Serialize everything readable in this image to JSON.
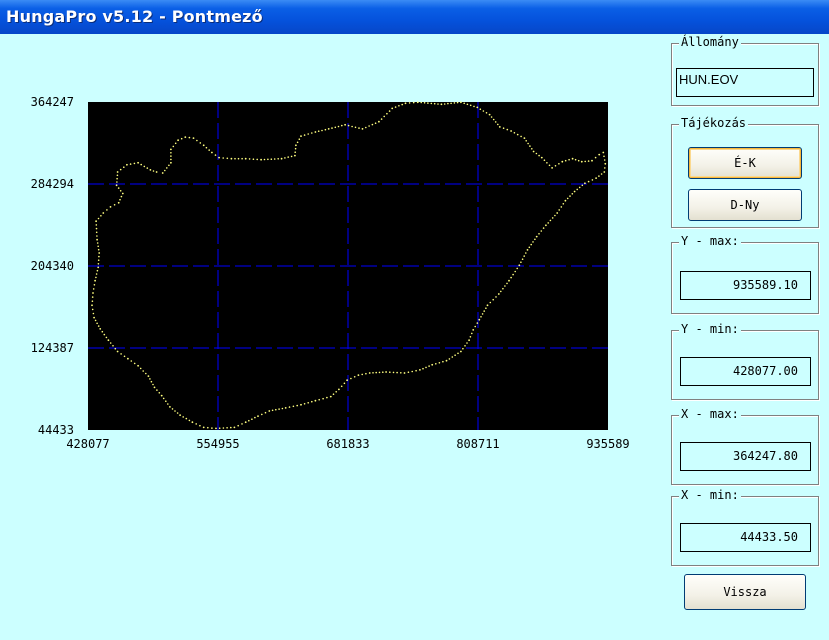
{
  "window": {
    "title": "HungaPro v5.12 - Pontmező"
  },
  "allomany": {
    "label": "Állomány",
    "value": "HUN.EOV"
  },
  "tajekozas": {
    "label": "Tájékozás",
    "ek_label": "É-K",
    "dny_label": "D-Ny"
  },
  "ymax": {
    "label": "Y - max:",
    "value": "935589.10"
  },
  "ymin": {
    "label": "Y - min:",
    "value": "428077.00"
  },
  "xmax": {
    "label": "X - max:",
    "value": "364247.80"
  },
  "xmin": {
    "label": "X - min:",
    "value": "44433.50"
  },
  "vissza_label": "Vissza",
  "colors": {
    "plot_bg": "#000000",
    "grid": "#0000ff",
    "points": "#ffff80",
    "client_bg": "#ccffff",
    "title_bar": "#0552dc"
  },
  "chart_data": {
    "type": "scatter",
    "title": "",
    "xlabel": "",
    "ylabel": "",
    "xlim": [
      428077,
      935589
    ],
    "ylim": [
      44433,
      364247
    ],
    "x_ticks": [
      "428077",
      "554955",
      "681833",
      "808711",
      "935589"
    ],
    "y_ticks": [
      "364247",
      "284294",
      "204340",
      "124387",
      "44433"
    ],
    "grid": true,
    "series": [
      {
        "points": [
          [
            436000,
            248000
          ],
          [
            443000,
            256000
          ],
          [
            450000,
            262000
          ],
          [
            458000,
            266000
          ],
          [
            462000,
            275000
          ],
          [
            456000,
            283000
          ],
          [
            457000,
            296000
          ],
          [
            466000,
            303000
          ],
          [
            477000,
            305000
          ],
          [
            489000,
            298000
          ],
          [
            495000,
            296000
          ],
          [
            501000,
            295000
          ],
          [
            509000,
            305000
          ],
          [
            509000,
            318000
          ],
          [
            516000,
            327000
          ],
          [
            523000,
            330000
          ],
          [
            531000,
            329000
          ],
          [
            541000,
            322000
          ],
          [
            549000,
            315000
          ],
          [
            556000,
            310000
          ],
          [
            568000,
            309000
          ],
          [
            582000,
            309000
          ],
          [
            597000,
            308000
          ],
          [
            617000,
            309000
          ],
          [
            630000,
            312000
          ],
          [
            631000,
            322000
          ],
          [
            636000,
            331000
          ],
          [
            650000,
            335000
          ],
          [
            663000,
            338000
          ],
          [
            679000,
            342000
          ],
          [
            696000,
            338000
          ],
          [
            712000,
            345000
          ],
          [
            725000,
            358000
          ],
          [
            738000,
            363000
          ],
          [
            750000,
            364000
          ],
          [
            773000,
            362000
          ],
          [
            792000,
            364000
          ],
          [
            808000,
            359000
          ],
          [
            820000,
            352000
          ],
          [
            830000,
            340000
          ],
          [
            841000,
            336000
          ],
          [
            854000,
            329000
          ],
          [
            863000,
            316000
          ],
          [
            871000,
            310000
          ],
          [
            881000,
            300000
          ],
          [
            891000,
            306000
          ],
          [
            901000,
            309000
          ],
          [
            910000,
            306000
          ],
          [
            920000,
            307000
          ],
          [
            927000,
            313000
          ],
          [
            931000,
            315000
          ],
          [
            933000,
            304000
          ],
          [
            932000,
            296000
          ],
          [
            924000,
            290000
          ],
          [
            913000,
            285000
          ],
          [
            903000,
            277000
          ],
          [
            894000,
            268000
          ],
          [
            886000,
            256000
          ],
          [
            875000,
            244000
          ],
          [
            866000,
            233000
          ],
          [
            857000,
            220000
          ],
          [
            849000,
            205000
          ],
          [
            839000,
            190000
          ],
          [
            829000,
            177000
          ],
          [
            818000,
            166000
          ],
          [
            810000,
            152000
          ],
          [
            804000,
            142000
          ],
          [
            800000,
            132000
          ],
          [
            792000,
            121000
          ],
          [
            778000,
            112000
          ],
          [
            764000,
            108000
          ],
          [
            752000,
            103000
          ],
          [
            737000,
            100000
          ],
          [
            719000,
            101000
          ],
          [
            703000,
            100000
          ],
          [
            692000,
            98000
          ],
          [
            681000,
            93000
          ],
          [
            673000,
            84000
          ],
          [
            665000,
            77000
          ],
          [
            650000,
            73000
          ],
          [
            636000,
            69000
          ],
          [
            621000,
            66000
          ],
          [
            605000,
            63000
          ],
          [
            594000,
            58000
          ],
          [
            582000,
            52000
          ],
          [
            571000,
            47000
          ],
          [
            553000,
            46000
          ],
          [
            541000,
            47000
          ],
          [
            530000,
            52000
          ],
          [
            518000,
            59000
          ],
          [
            508000,
            67000
          ],
          [
            500000,
            78000
          ],
          [
            493000,
            86000
          ],
          [
            487000,
            97000
          ],
          [
            477000,
            107000
          ],
          [
            467000,
            114000
          ],
          [
            457000,
            121000
          ],
          [
            448000,
            132000
          ],
          [
            440000,
            143000
          ],
          [
            434000,
            154000
          ],
          [
            432000,
            166000
          ],
          [
            433000,
            178000
          ],
          [
            435000,
            190000
          ],
          [
            438000,
            203000
          ],
          [
            439000,
            217000
          ],
          [
            437000,
            230000
          ]
        ]
      }
    ]
  }
}
